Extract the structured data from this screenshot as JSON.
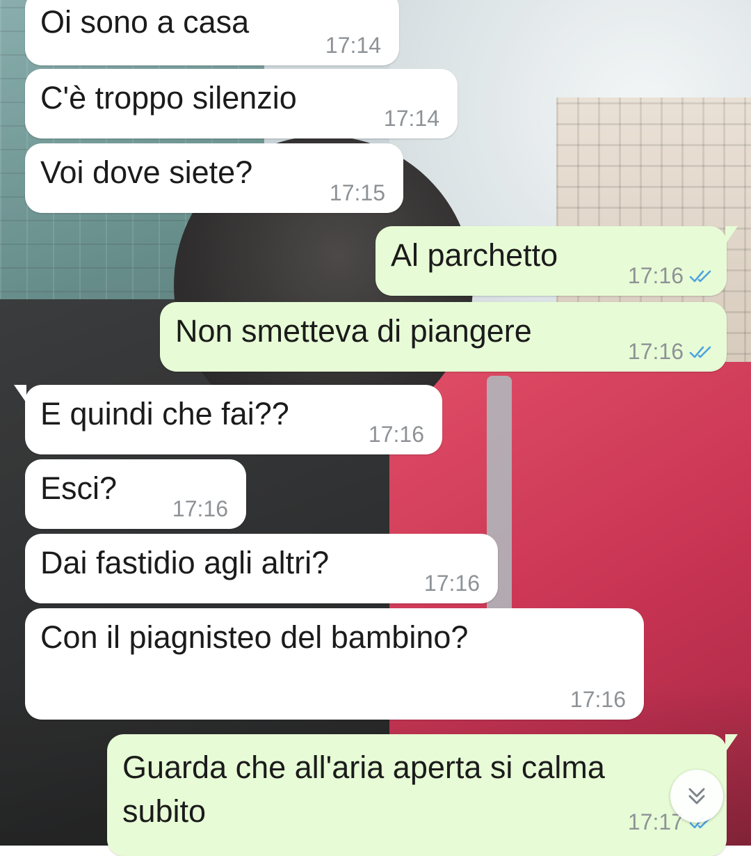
{
  "messages": [
    {
      "dir": "in",
      "text": "Oi sono a casa",
      "time": "17:14"
    },
    {
      "dir": "in",
      "text": "C'è troppo silenzio",
      "time": "17:14"
    },
    {
      "dir": "in",
      "text": "Voi dove siete?",
      "time": "17:15"
    },
    {
      "dir": "out",
      "text": "Al parchetto",
      "time": "17:16",
      "status": "read"
    },
    {
      "dir": "out",
      "text": "Non smetteva di piangere",
      "time": "17:16",
      "status": "read"
    },
    {
      "dir": "in",
      "text": "E quindi che fai??",
      "time": "17:16"
    },
    {
      "dir": "in",
      "text": "Esci?",
      "time": "17:16"
    },
    {
      "dir": "in",
      "text": "Dai fastidio agli altri?",
      "time": "17:16"
    },
    {
      "dir": "in",
      "text": "Con il piagnisteo del bambino?",
      "time": "17:16"
    },
    {
      "dir": "out",
      "text": "Guarda che all'aria aperta si calma",
      "text2": "subito",
      "time": "17:17",
      "status": "read"
    }
  ],
  "colors": {
    "incoming_bubble": "#ffffff",
    "outgoing_bubble": "#e7fcd6",
    "read_ticks": "#4fa3e0",
    "timestamp": "#8e9296"
  },
  "scroll_button": {
    "icon": "double-chevron-down-icon"
  }
}
